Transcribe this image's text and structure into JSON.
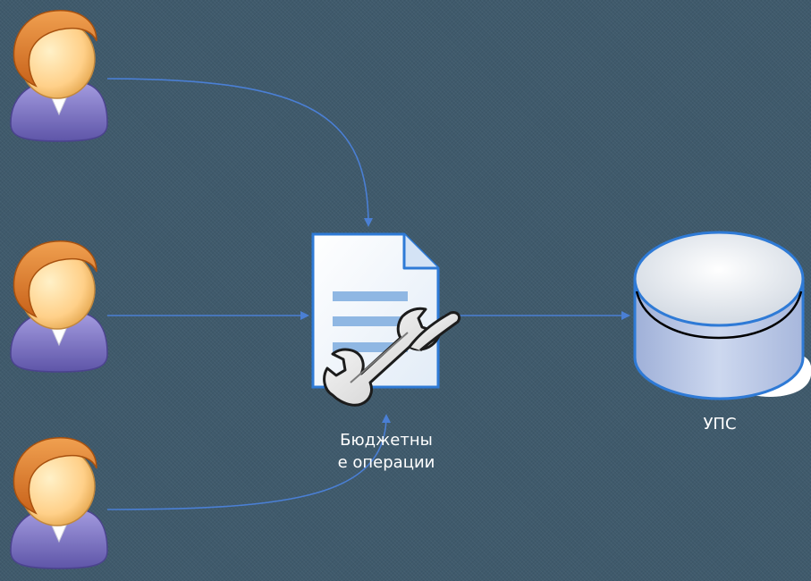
{
  "diagram": {
    "document_label_line1": "Бюджетны",
    "document_label_line2": "е операции",
    "database_label": "УПС",
    "icons": {
      "users": [
        "user-icon",
        "user-icon",
        "user-icon"
      ],
      "document": "document-icon",
      "tool": "wrench-icon",
      "database": "database-icon"
    },
    "colors": {
      "background": "#3f5a6c",
      "connector": "#4a7fd4",
      "label_text": "#ffffff",
      "user_face": "#ffd089",
      "user_hair": "#e07a1a",
      "user_body": "#7c74c4",
      "document_lines": "#8fb7e3",
      "database_body": "#bfcbe6",
      "database_top": "#e9edf2"
    }
  }
}
